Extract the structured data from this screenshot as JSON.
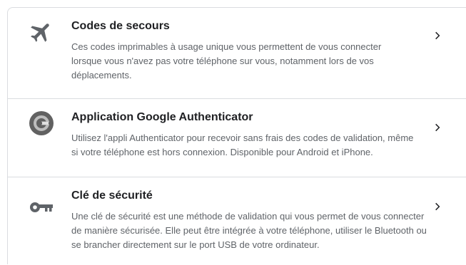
{
  "options": [
    {
      "title": "Codes de secours",
      "description": "Ces codes imprimables à usage unique vous permettent de vous connecter lorsque vous n'avez pas votre téléphone sur vous, notamment lors de vos déplacements.",
      "icon": "airplane-icon"
    },
    {
      "title": "Application Google Authenticator",
      "description": "Utilisez l'appli Authenticator pour recevoir sans frais des codes de validation, même si votre téléphone est hors connexion. Disponible pour Android et iPhone.",
      "icon": "google-authenticator-icon"
    },
    {
      "title": "Clé de sécurité",
      "description": "Une clé de sécurité est une méthode de validation qui vous permet de vous connecter de manière sécurisée. Elle peut être intégrée à votre téléphone, utiliser le Bluetooth ou se brancher directement sur le port USB de votre ordinateur.",
      "icon": "key-icon"
    }
  ],
  "colors": {
    "title": "#202124",
    "description": "#5f6368",
    "divider": "#dadce0",
    "icon": "#5f6368"
  }
}
